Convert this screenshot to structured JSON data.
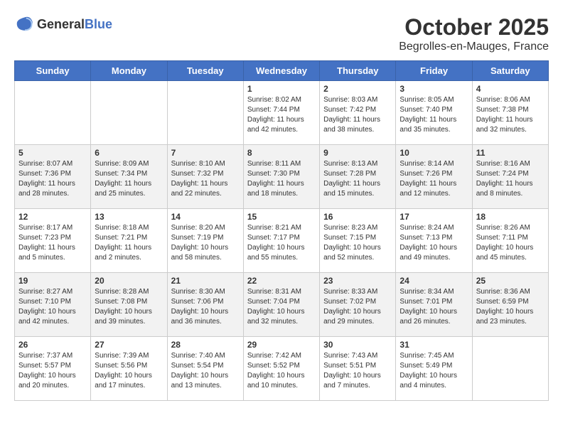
{
  "header": {
    "logo_general": "General",
    "logo_blue": "Blue",
    "month_title": "October 2025",
    "location": "Begrolles-en-Mauges, France"
  },
  "weekdays": [
    "Sunday",
    "Monday",
    "Tuesday",
    "Wednesday",
    "Thursday",
    "Friday",
    "Saturday"
  ],
  "weeks": [
    [
      {
        "day": "",
        "info": ""
      },
      {
        "day": "",
        "info": ""
      },
      {
        "day": "",
        "info": ""
      },
      {
        "day": "1",
        "info": "Sunrise: 8:02 AM\nSunset: 7:44 PM\nDaylight: 11 hours\nand 42 minutes."
      },
      {
        "day": "2",
        "info": "Sunrise: 8:03 AM\nSunset: 7:42 PM\nDaylight: 11 hours\nand 38 minutes."
      },
      {
        "day": "3",
        "info": "Sunrise: 8:05 AM\nSunset: 7:40 PM\nDaylight: 11 hours\nand 35 minutes."
      },
      {
        "day": "4",
        "info": "Sunrise: 8:06 AM\nSunset: 7:38 PM\nDaylight: 11 hours\nand 32 minutes."
      }
    ],
    [
      {
        "day": "5",
        "info": "Sunrise: 8:07 AM\nSunset: 7:36 PM\nDaylight: 11 hours\nand 28 minutes."
      },
      {
        "day": "6",
        "info": "Sunrise: 8:09 AM\nSunset: 7:34 PM\nDaylight: 11 hours\nand 25 minutes."
      },
      {
        "day": "7",
        "info": "Sunrise: 8:10 AM\nSunset: 7:32 PM\nDaylight: 11 hours\nand 22 minutes."
      },
      {
        "day": "8",
        "info": "Sunrise: 8:11 AM\nSunset: 7:30 PM\nDaylight: 11 hours\nand 18 minutes."
      },
      {
        "day": "9",
        "info": "Sunrise: 8:13 AM\nSunset: 7:28 PM\nDaylight: 11 hours\nand 15 minutes."
      },
      {
        "day": "10",
        "info": "Sunrise: 8:14 AM\nSunset: 7:26 PM\nDaylight: 11 hours\nand 12 minutes."
      },
      {
        "day": "11",
        "info": "Sunrise: 8:16 AM\nSunset: 7:24 PM\nDaylight: 11 hours\nand 8 minutes."
      }
    ],
    [
      {
        "day": "12",
        "info": "Sunrise: 8:17 AM\nSunset: 7:23 PM\nDaylight: 11 hours\nand 5 minutes."
      },
      {
        "day": "13",
        "info": "Sunrise: 8:18 AM\nSunset: 7:21 PM\nDaylight: 11 hours\nand 2 minutes."
      },
      {
        "day": "14",
        "info": "Sunrise: 8:20 AM\nSunset: 7:19 PM\nDaylight: 10 hours\nand 58 minutes."
      },
      {
        "day": "15",
        "info": "Sunrise: 8:21 AM\nSunset: 7:17 PM\nDaylight: 10 hours\nand 55 minutes."
      },
      {
        "day": "16",
        "info": "Sunrise: 8:23 AM\nSunset: 7:15 PM\nDaylight: 10 hours\nand 52 minutes."
      },
      {
        "day": "17",
        "info": "Sunrise: 8:24 AM\nSunset: 7:13 PM\nDaylight: 10 hours\nand 49 minutes."
      },
      {
        "day": "18",
        "info": "Sunrise: 8:26 AM\nSunset: 7:11 PM\nDaylight: 10 hours\nand 45 minutes."
      }
    ],
    [
      {
        "day": "19",
        "info": "Sunrise: 8:27 AM\nSunset: 7:10 PM\nDaylight: 10 hours\nand 42 minutes."
      },
      {
        "day": "20",
        "info": "Sunrise: 8:28 AM\nSunset: 7:08 PM\nDaylight: 10 hours\nand 39 minutes."
      },
      {
        "day": "21",
        "info": "Sunrise: 8:30 AM\nSunset: 7:06 PM\nDaylight: 10 hours\nand 36 minutes."
      },
      {
        "day": "22",
        "info": "Sunrise: 8:31 AM\nSunset: 7:04 PM\nDaylight: 10 hours\nand 32 minutes."
      },
      {
        "day": "23",
        "info": "Sunrise: 8:33 AM\nSunset: 7:02 PM\nDaylight: 10 hours\nand 29 minutes."
      },
      {
        "day": "24",
        "info": "Sunrise: 8:34 AM\nSunset: 7:01 PM\nDaylight: 10 hours\nand 26 minutes."
      },
      {
        "day": "25",
        "info": "Sunrise: 8:36 AM\nSunset: 6:59 PM\nDaylight: 10 hours\nand 23 minutes."
      }
    ],
    [
      {
        "day": "26",
        "info": "Sunrise: 7:37 AM\nSunset: 5:57 PM\nDaylight: 10 hours\nand 20 minutes."
      },
      {
        "day": "27",
        "info": "Sunrise: 7:39 AM\nSunset: 5:56 PM\nDaylight: 10 hours\nand 17 minutes."
      },
      {
        "day": "28",
        "info": "Sunrise: 7:40 AM\nSunset: 5:54 PM\nDaylight: 10 hours\nand 13 minutes."
      },
      {
        "day": "29",
        "info": "Sunrise: 7:42 AM\nSunset: 5:52 PM\nDaylight: 10 hours\nand 10 minutes."
      },
      {
        "day": "30",
        "info": "Sunrise: 7:43 AM\nSunset: 5:51 PM\nDaylight: 10 hours\nand 7 minutes."
      },
      {
        "day": "31",
        "info": "Sunrise: 7:45 AM\nSunset: 5:49 PM\nDaylight: 10 hours\nand 4 minutes."
      },
      {
        "day": "",
        "info": ""
      }
    ]
  ]
}
